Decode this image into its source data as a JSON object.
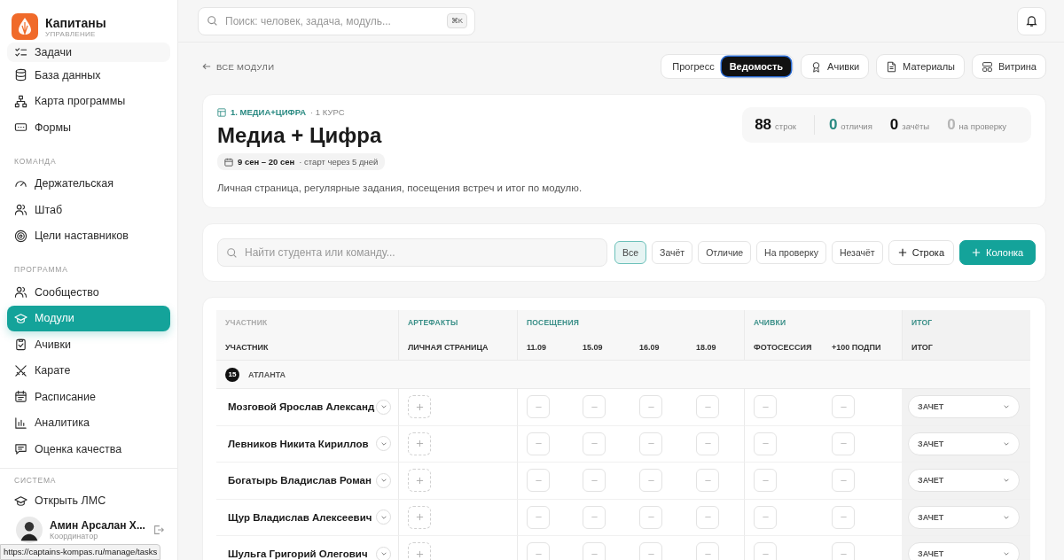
{
  "brand": {
    "name": "Капитаны",
    "subtitle": "УПРАВЛЕНИЕ"
  },
  "sidebar": {
    "sections": [
      {
        "items": [
          {
            "label": "Задачи",
            "selected": false
          },
          {
            "label": "База данных",
            "selected": false
          },
          {
            "label": "Карта программы",
            "selected": false
          },
          {
            "label": "Формы",
            "selected": false
          }
        ]
      },
      {
        "title": "КОМАНДА",
        "items": [
          {
            "label": "Держательская",
            "selected": false
          },
          {
            "label": "Штаб",
            "selected": false
          },
          {
            "label": "Цели наставников",
            "selected": false
          }
        ]
      },
      {
        "title": "ПРОГРАММА",
        "items": [
          {
            "label": "Сообщество",
            "selected": false
          },
          {
            "label": "Модули",
            "selected": true
          },
          {
            "label": "Ачивки",
            "selected": false
          },
          {
            "label": "Карате",
            "selected": false
          },
          {
            "label": "Расписание",
            "selected": false
          },
          {
            "label": "Аналитика",
            "selected": false
          },
          {
            "label": "Оценка качества",
            "selected": false
          }
        ]
      },
      {
        "title": "СИСТЕМА",
        "items": [
          {
            "label": "Открыть ЛМС",
            "selected": false
          }
        ]
      }
    ],
    "user": {
      "name": "Амин Арсалан Х...",
      "role": "Координатор"
    }
  },
  "status_url": "https://captains-kompas.ru/manage/tasks",
  "search": {
    "placeholder": "Поиск: человек, задача, модуль...",
    "shortcut": "⌘K"
  },
  "back_link": "ВСЕ МОДУЛИ",
  "view_tabs": [
    {
      "label": "Прогресс",
      "selected": false
    },
    {
      "label": "Ведомость",
      "selected": true
    }
  ],
  "view_buttons": [
    "Ачивки",
    "Материалы",
    "Витрина"
  ],
  "module": {
    "tag": "1. МЕДИА+ЦИФРА",
    "course": "· 1 КУРС",
    "title": "Медиа + Цифра",
    "dates": "9 сен – 20 сен",
    "start_note": "· старт через 5 дней",
    "description": "Личная страница, регулярные задания, посещения встреч и итог по модулю."
  },
  "stats": [
    {
      "value": "88",
      "label": "строк",
      "color": "#111111"
    },
    {
      "value": "0",
      "label": "отличия",
      "color": "#2a8a82"
    },
    {
      "value": "0",
      "label": "зачёты",
      "color": "#111111"
    },
    {
      "value": "0",
      "label": "на проверку",
      "color": "#b5b5b5"
    }
  ],
  "student_search": {
    "placeholder": "Найти студента или команду..."
  },
  "filters": [
    {
      "label": "Все",
      "selected": true
    },
    {
      "label": "Зачёт",
      "selected": false
    },
    {
      "label": "Отличие",
      "selected": false
    },
    {
      "label": "На проверку",
      "selected": false
    },
    {
      "label": "Незачёт",
      "selected": false
    }
  ],
  "actions": [
    {
      "label": "Строка",
      "kind": "secondary"
    },
    {
      "label": "Колонка",
      "kind": "primary"
    }
  ],
  "table": {
    "groups": [
      "УЧАСТНИК",
      "АРТЕФАКТЫ",
      "ПОСЕЩЕНИЯ",
      "АЧИВКИ",
      "ИТОГ"
    ],
    "columns": [
      "УЧАСТНИК",
      "ЛИЧНАЯ СТРАНИЦА",
      "11.09",
      "15.09",
      "16.09",
      "18.09",
      "ФОТОСЕССИЯ",
      "+100 ПОДПИ",
      "ИТОГ"
    ],
    "team": {
      "count": "15",
      "name": "АТЛАНТА"
    },
    "rows": [
      {
        "name": "Мозговой Ярослав Александ",
        "result": "ЗАЧЕТ"
      },
      {
        "name": "Левников Никита Кириллов",
        "result": "ЗАЧЕТ"
      },
      {
        "name": "Богатырь Владислав Роман",
        "result": "ЗАЧЕТ"
      },
      {
        "name": "Щур Владислав Алексеевич",
        "result": "ЗАЧЕТ"
      },
      {
        "name": "Шульга Григорий Олегович",
        "result": "ЗАЧЕТ"
      }
    ]
  }
}
